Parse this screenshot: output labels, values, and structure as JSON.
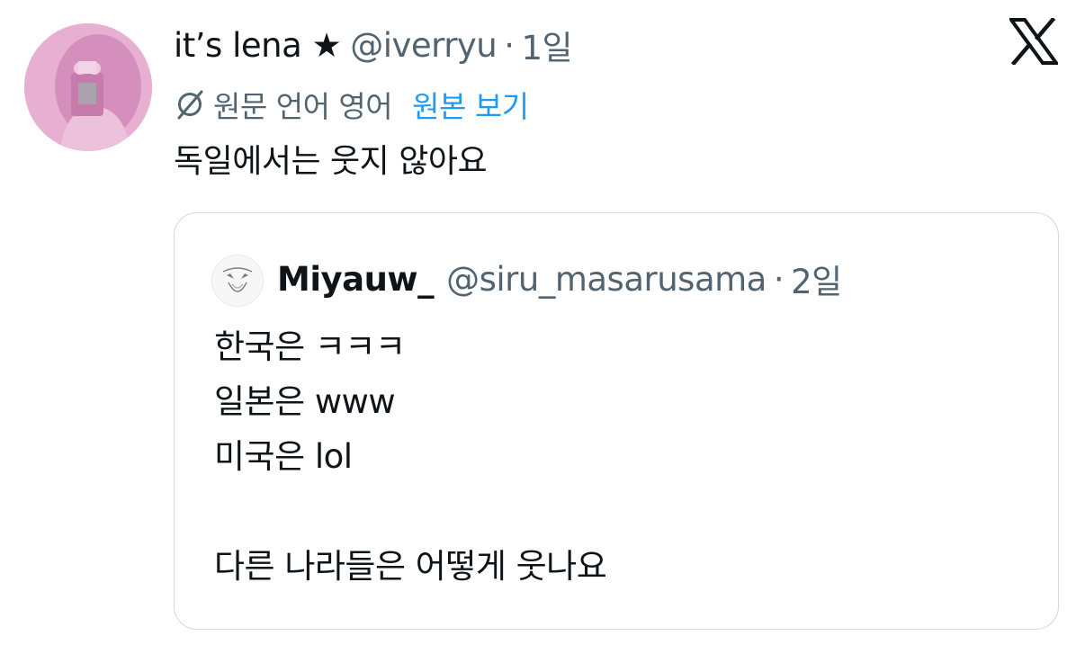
{
  "tweet": {
    "display_name": "it’s lena ★",
    "handle": "@iverryu",
    "separator": "·",
    "time": "1일",
    "translation": {
      "source_language_text": "원문 언어 영어",
      "show_original_label": "원본 보기"
    },
    "text": "독일에서는 웃지 않아요"
  },
  "quoted_tweet": {
    "display_name": "Miyauw_",
    "handle": "@siru_masarusama",
    "separator": "·",
    "time": "2일",
    "lines": [
      "한국은 ㅋㅋㅋ",
      "일본은 www",
      "미국은 lol",
      "",
      "다른 나라들은 어떻게 웃나요"
    ]
  },
  "icons": {
    "platform": "x-logo-icon",
    "translate": "globe-slash-icon"
  },
  "colors": {
    "text_primary": "#0f1419",
    "text_secondary": "#536471",
    "link": "#1d9bf0",
    "border": "#cfd9de",
    "avatar_pink": "#e3a6cc"
  }
}
